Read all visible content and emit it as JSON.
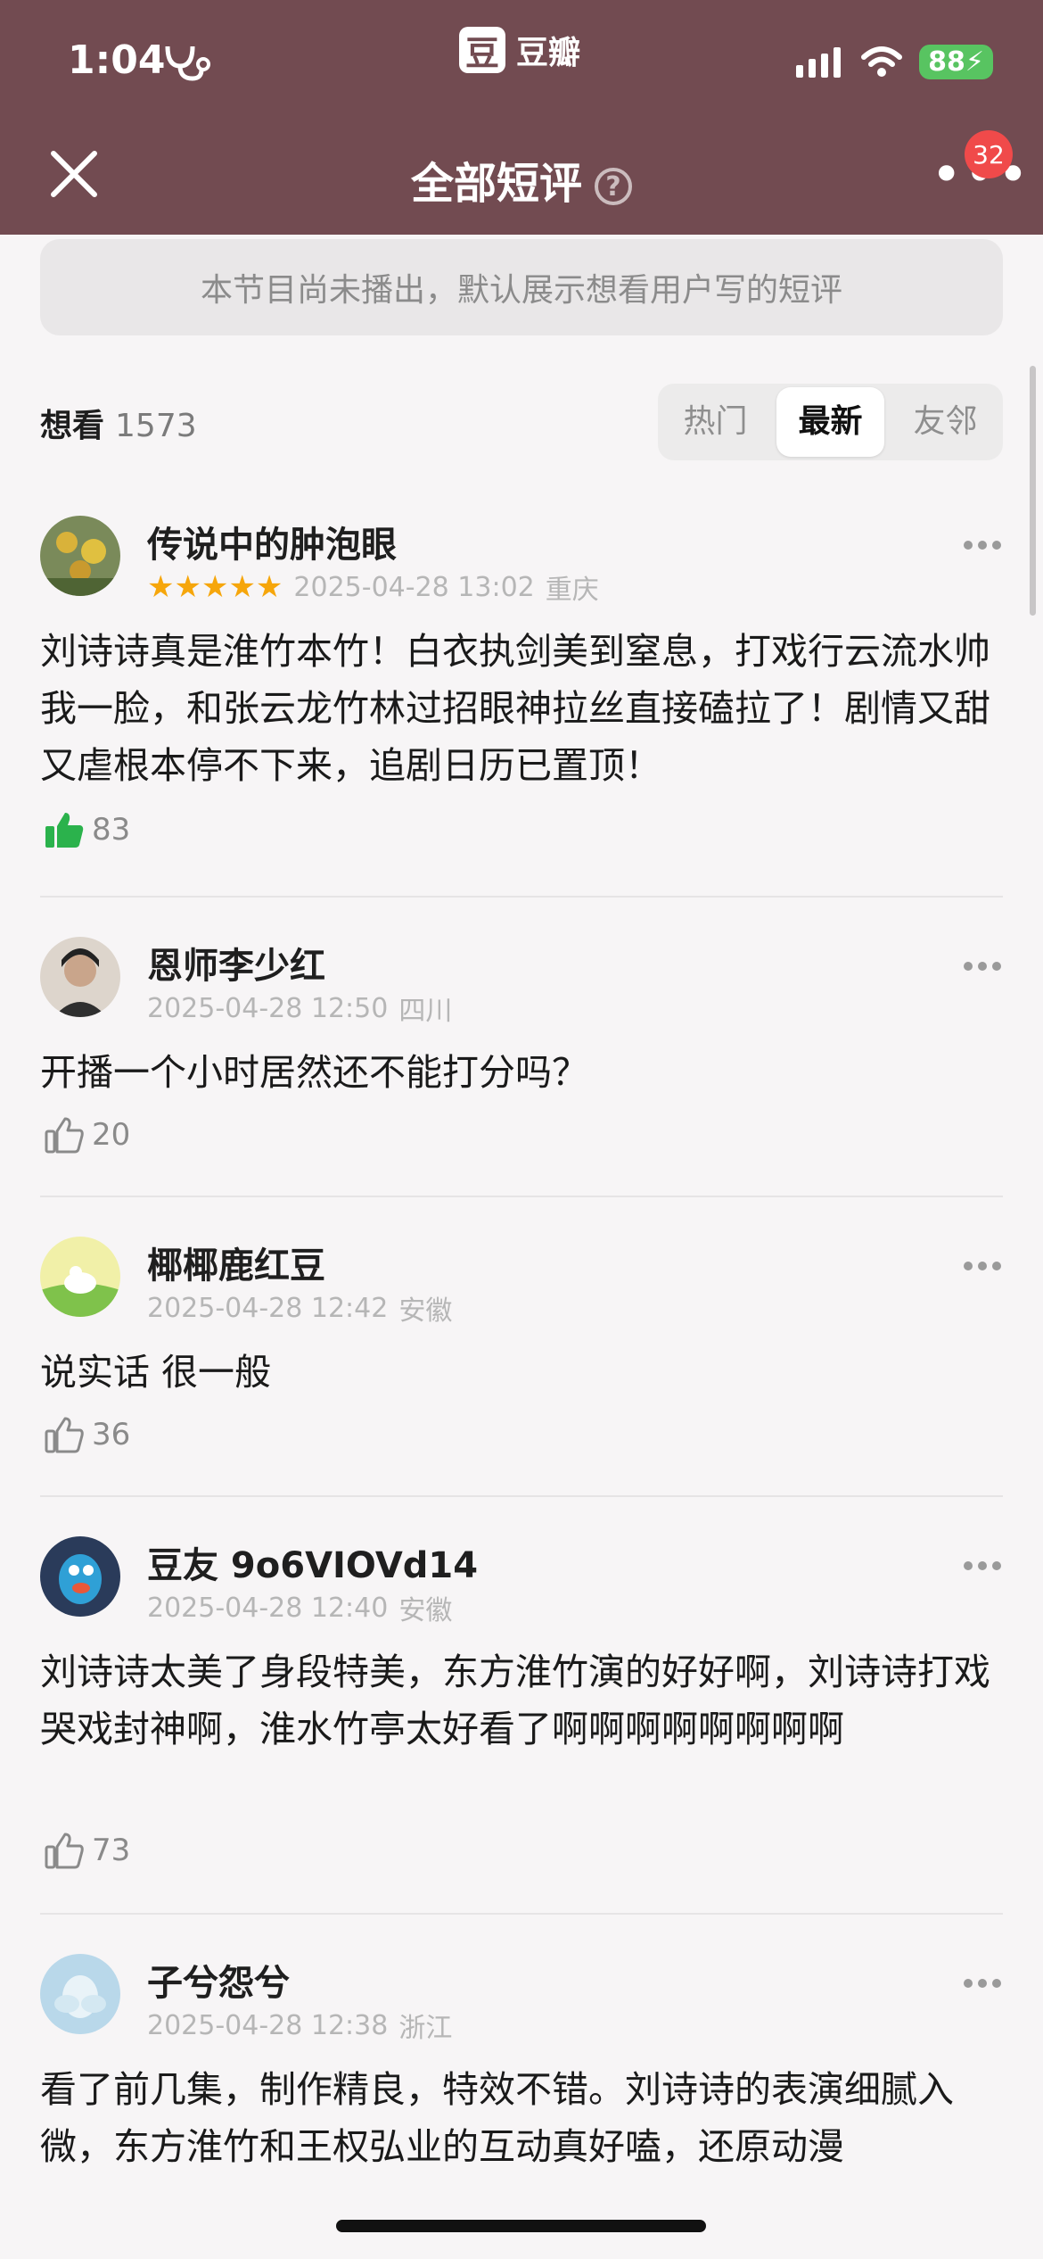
{
  "status_bar": {
    "time": "1:04",
    "app_logo": "豆",
    "app_name": "豆瓣",
    "battery": "88"
  },
  "nav": {
    "title": "全部短评",
    "help": "?",
    "badge": "32"
  },
  "notice": "本节目尚未播出，默认展示想看用户写的短评",
  "count": {
    "label": "想看",
    "value": "1573"
  },
  "tabs": [
    {
      "label": "热门"
    },
    {
      "label": "最新"
    },
    {
      "label": "友邻"
    }
  ],
  "reviews": [
    {
      "name": "传说中的肿泡眼",
      "stars": "★★★★★",
      "date": "2025-04-28 13:02",
      "location": "重庆",
      "content": "刘诗诗真是淮竹本竹！白衣执剑美到窒息，打戏行云流水帅我一脸，和张云龙竹林过招眼神拉丝直接磕拉了！剧情又甜又虐根本停不下来，追剧日历已置顶！",
      "likes": "83",
      "liked": true
    },
    {
      "name": "恩师李少红",
      "stars": "",
      "date": "2025-04-28 12:50",
      "location": "四川",
      "content": "开播一个小时居然还不能打分吗？",
      "likes": "20",
      "liked": false
    },
    {
      "name": "椰椰鹿红豆",
      "stars": "",
      "date": "2025-04-28 12:42",
      "location": "安徽",
      "content": "说实话 很一般",
      "likes": "36",
      "liked": false
    },
    {
      "name": "豆友 9o6VIOVd14",
      "stars": "",
      "date": "2025-04-28 12:40",
      "location": "安徽",
      "content": "刘诗诗太美了身段特美，东方淮竹演的好好啊，刘诗诗打戏哭戏封神啊，淮水竹亭太好看了啊啊啊啊啊啊啊啊",
      "likes": "73",
      "liked": false
    },
    {
      "name": "子兮怨兮",
      "stars": "",
      "date": "2025-04-28 12:38",
      "location": "浙江",
      "content": "看了前几集，制作精良，特效不错。刘诗诗的表演细腻入微，东方淮竹和王权弘业的互动真好嗑，还原动漫",
      "likes": "",
      "liked": false
    }
  ],
  "colors": {
    "header": "#724b51",
    "star": "#f6a60b",
    "like_active": "#2bb24c"
  }
}
